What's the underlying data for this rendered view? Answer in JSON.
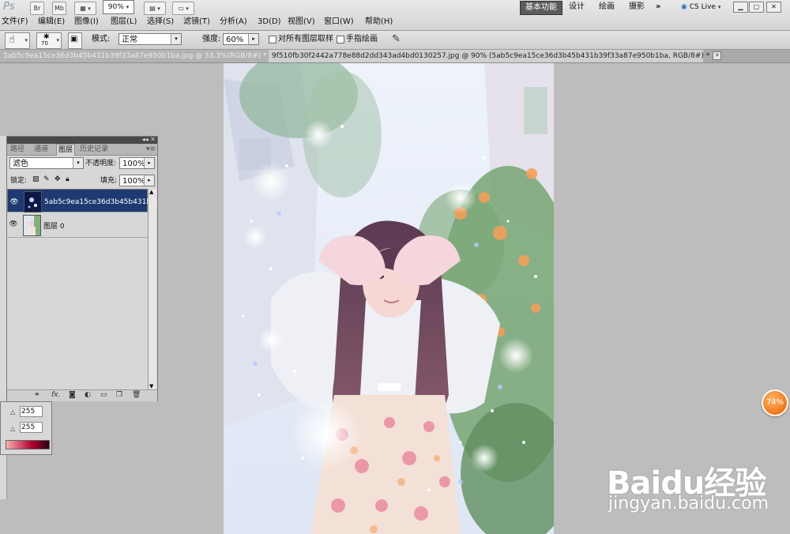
{
  "app": {
    "logo": "Ps",
    "bridge_button": "Br",
    "minibridge_button": "Mb",
    "zoom_value": "90%",
    "workspaces": [
      "基本功能",
      "设计",
      "绘画",
      "摄影"
    ],
    "more_workspaces": "»",
    "cs_live": "CS Live"
  },
  "menu": [
    "文件(F)",
    "编辑(E)",
    "图像(I)",
    "图层(L)",
    "选择(S)",
    "滤镜(T)",
    "分析(A)",
    "3D(D)",
    "视图(V)",
    "窗口(W)",
    "帮助(H)"
  ],
  "options": {
    "brush_size": "70",
    "mode_label": "模式:",
    "mode_value": "正常",
    "strength_label": "强度:",
    "strength_value": "60%",
    "sample_all_label": "对所有图层取样",
    "finger_paint_label": "手指绘画"
  },
  "tabs": [
    {
      "title": "5ab5c9ea15ce36d3b45b431b39f33a87e950b1ba.jpg @ 33.3%(RGB/8#) *"
    },
    {
      "title": "9f510fb30f2442a778e88d2dd343ad4bd0130257.jpg @ 90% (5ab5c9ea15ce36d3b45b431b39f33a87e950b1ba, RGB/8#) *"
    }
  ],
  "layers_panel": {
    "tabs": [
      "路径",
      "通道",
      "图层",
      "历史记录"
    ],
    "active_tab": "图层",
    "blend_mode": "滤色",
    "opacity_label": "不透明度:",
    "opacity_value": "100%",
    "lock_label": "锁定:",
    "fill_label": "填充:",
    "fill_value": "100%",
    "layers": [
      {
        "name": "5ab5c9ea15ce36d3b45b431b...",
        "selected": true
      },
      {
        "name": "图层 0",
        "selected": false
      }
    ],
    "footer_fx": "fx."
  },
  "color_panel": {
    "value_1": "255",
    "value_2": "255"
  },
  "zoom_badge": "74%",
  "watermark": {
    "brand": "Baidu经验",
    "url": "jingyan.baidu.com"
  },
  "colors": {
    "selected_layer": "#1f3a72",
    "badge": "#f07a1c",
    "ui_bg": "#bdbdbd"
  }
}
